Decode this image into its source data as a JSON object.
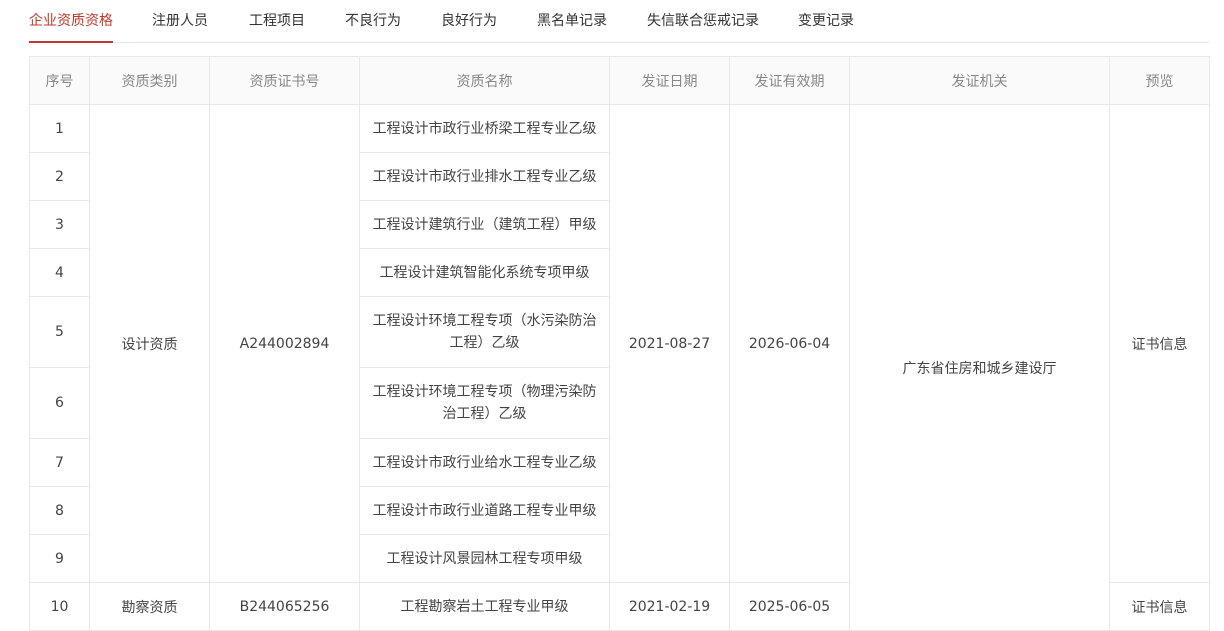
{
  "tabs": [
    {
      "label": "企业资质资格",
      "active": true
    },
    {
      "label": "注册人员"
    },
    {
      "label": "工程项目"
    },
    {
      "label": "不良行为"
    },
    {
      "label": "良好行为"
    },
    {
      "label": "黑名单记录"
    },
    {
      "label": "失信联合惩戒记录"
    },
    {
      "label": "变更记录"
    }
  ],
  "table": {
    "headers": [
      "序号",
      "资质类别",
      "资质证书号",
      "资质名称",
      "发证日期",
      "发证有效期",
      "发证机关",
      "预览"
    ],
    "rows": [
      {
        "no": "1",
        "name": "工程设计市政行业桥梁工程专业乙级"
      },
      {
        "no": "2",
        "name": "工程设计市政行业排水工程专业乙级"
      },
      {
        "no": "3",
        "name": "工程设计建筑行业（建筑工程）甲级"
      },
      {
        "no": "4",
        "name": "工程设计建筑智能化系统专项甲级"
      },
      {
        "no": "5",
        "name": "工程设计环境工程专项（水污染防治工程）乙级"
      },
      {
        "no": "6",
        "name": "工程设计环境工程专项（物理污染防治工程）乙级"
      },
      {
        "no": "7",
        "name": "工程设计市政行业给水工程专业乙级"
      },
      {
        "no": "8",
        "name": "工程设计市政行业道路工程专业甲级"
      },
      {
        "no": "9",
        "name": "工程设计风景园林工程专项甲级"
      },
      {
        "no": "10",
        "name": "工程勘察岩土工程专业甲级"
      }
    ],
    "groups": [
      {
        "category": "设计资质",
        "cert_no": "A244002894",
        "issue_date": "2021-08-27",
        "valid_until": "2026-06-04",
        "preview": "证书信息"
      },
      {
        "category": "勘察资质",
        "cert_no": "B244065256",
        "issue_date": "2021-02-19",
        "valid_until": "2025-06-05",
        "preview": "证书信息"
      }
    ],
    "issuer": "广东省住房和城乡建设厅"
  }
}
